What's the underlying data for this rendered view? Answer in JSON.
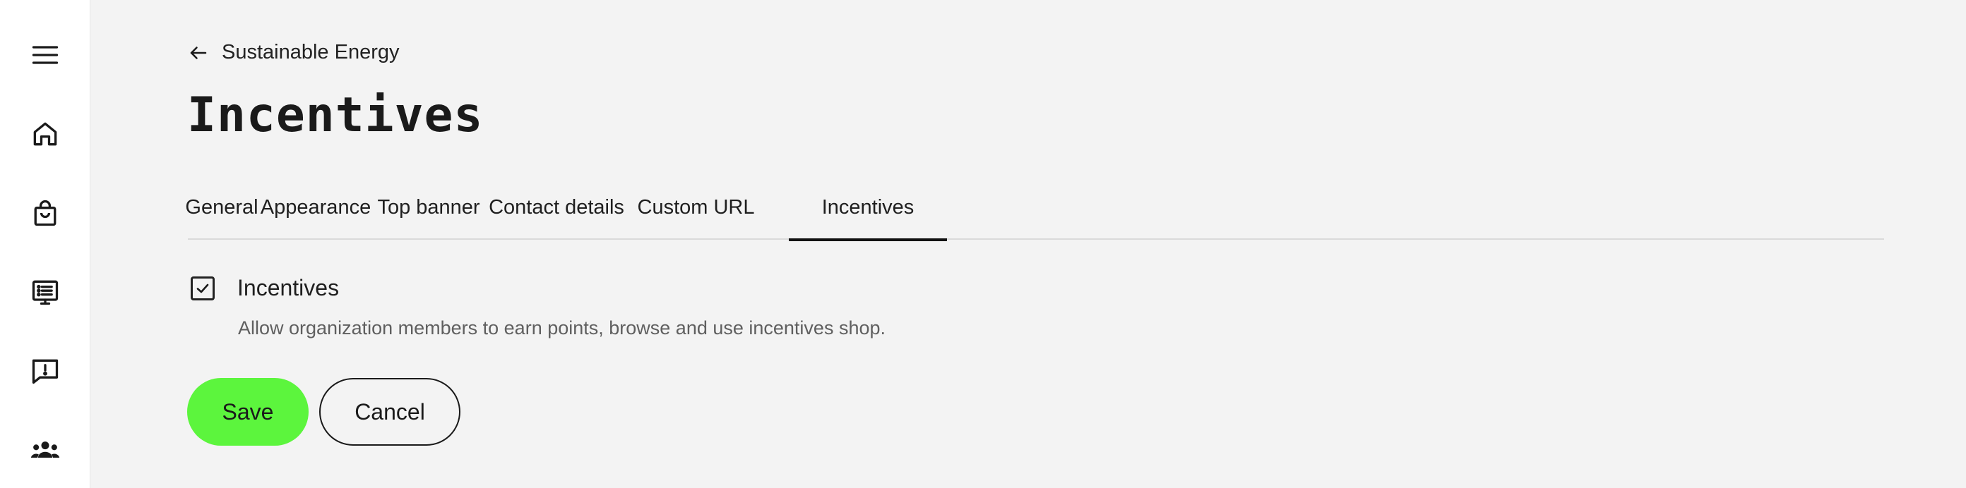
{
  "sidebar": {
    "items": [
      {
        "icon": "menu-icon"
      },
      {
        "icon": "home-icon"
      },
      {
        "icon": "shopping-bag-icon"
      },
      {
        "icon": "list-board-icon"
      },
      {
        "icon": "report-icon"
      },
      {
        "icon": "group-icon"
      }
    ]
  },
  "header": {
    "back_label": "Sustainable Energy",
    "title": "Incentives"
  },
  "tabs": [
    {
      "label": "General",
      "active": false
    },
    {
      "label": "Appearance",
      "active": false
    },
    {
      "label": "Top banner",
      "active": false
    },
    {
      "label": "Contact details",
      "active": false
    },
    {
      "label": "Custom URL",
      "active": false
    },
    {
      "label": "Incentives",
      "active": true
    }
  ],
  "form": {
    "incentives_checkbox": {
      "checked": true,
      "label": "Incentives",
      "help": "Allow organization members to earn points, browse and use incentives shop."
    },
    "save_label": "Save",
    "cancel_label": "Cancel"
  },
  "colors": {
    "background": "#f3f3f3",
    "primary_button": "#5cf53d",
    "text": "#1d1d1d"
  }
}
